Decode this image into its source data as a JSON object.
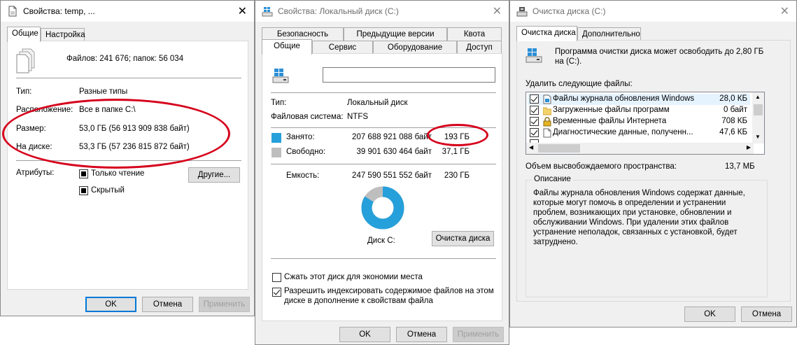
{
  "win1": {
    "title": "Свойства: temp, ...",
    "tabs": [
      "Общие",
      "Настройка"
    ],
    "summary": "Файлов: 241 676; папок: 56 034",
    "rows": [
      {
        "label": "Тип:",
        "value": "Разные типы"
      },
      {
        "label": "Расположение:",
        "value": "Все в папке C:\\"
      },
      {
        "label": "Размер:",
        "value": "53,0 ГБ (56 913 909 838 байт)"
      },
      {
        "label": "На диске:",
        "value": "53,3 ГБ (57 236 815 872 байт)"
      }
    ],
    "attributes_label": "Атрибуты:",
    "attr_readonly": "Только чтение",
    "attr_hidden": "Скрытый",
    "other_button": "Другие...",
    "ok": "OK",
    "cancel": "Отмена",
    "apply": "Применить"
  },
  "win2": {
    "title": "Свойства: Локальный диск (C:)",
    "tabs_top": [
      "Безопасность",
      "Предыдущие версии",
      "Квота"
    ],
    "tabs_bottom": [
      "Общие",
      "Сервис",
      "Оборудование",
      "Доступ"
    ],
    "name_value": "",
    "type_label": "Тип:",
    "type_value": "Локальный диск",
    "fs_label": "Файловая система:",
    "fs_value": "NTFS",
    "used_label": "Занято:",
    "used_bytes": "207 688 921 088 байт",
    "used_gb": "193 ГБ",
    "free_label": "Свободно:",
    "free_bytes": "39 901 630 464 байт",
    "free_gb": "37,1 ГБ",
    "capacity_label": "Емкость:",
    "capacity_bytes": "247 590 551 552 байт",
    "capacity_gb": "230 ГБ",
    "used_fraction": 0.839,
    "disk_label": "Диск C:",
    "cleanup_button": "Очистка диска",
    "compress_label": "Сжать этот диск для экономии места",
    "index_label_1": "Разрешить индексировать содержимое файлов на этом",
    "index_label_2": "диске в дополнение к свойствам файла",
    "ok": "OK",
    "cancel": "Отмена",
    "apply": "Применить",
    "colors": {
      "used": "#26a0da",
      "free": "#bebebe"
    }
  },
  "win3": {
    "title": "Очистка диска  (C:)",
    "tabs": [
      "Очистка диска",
      "Дополнительно"
    ],
    "intro_1": "Программа очистки диска может освободить до 2,80 ГБ",
    "intro_2": "на  (C:).",
    "delete_label": "Удалить следующие файлы:",
    "files": [
      {
        "name": "Файлы журнала обновления Windows",
        "size": "28,0 КБ",
        "checked": true,
        "icon": "log-file-icon"
      },
      {
        "name": "Загруженные файлы программ",
        "size": "0 байт",
        "checked": true,
        "icon": "folder-icon"
      },
      {
        "name": "Временные файлы Интернета",
        "size": "708 КБ",
        "checked": true,
        "icon": "lock-icon"
      },
      {
        "name": "Диагностические данные, полученн...",
        "size": "47,6 КБ",
        "checked": true,
        "icon": "document-icon"
      }
    ],
    "freed_label": "Объем высвобождаемого пространства:",
    "freed_value": "13,7 МБ",
    "description_label": "Описание",
    "description": [
      "Файлы журнала обновления Windows содержат данные,",
      "которые могут помочь в определении и устранении",
      "проблем, возникающих при установке, обновлении и",
      "обслуживании Windows. При удалении этих файлов",
      "устранение неполадок, связанных с установкой, будет",
      "затруднено."
    ],
    "ok": "OK",
    "cancel": "Отмена"
  }
}
